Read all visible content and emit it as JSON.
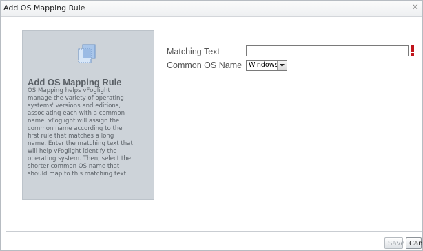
{
  "dialog": {
    "title": "Add OS Mapping Rule",
    "close_glyph": "×"
  },
  "help": {
    "icon": "copy-windows-icon",
    "title": "Add OS Mapping Rule",
    "lines": [
      "OS Mapping helps vFoglight",
      "manage the variety of operating",
      "systems' versions and editions,",
      "associating each with a common",
      "name. vFoglight will assign the",
      "common name according to the",
      "first rule that matches a long",
      "name. Enter the matching text that",
      "will help vFoglight identify the",
      "operating system. Then, select the",
      "shorter common OS name that",
      "should map to this matching text."
    ]
  },
  "form": {
    "matching_text_label": "Matching Text",
    "matching_text_value": "",
    "common_os_label": "Common OS Name",
    "common_os_selected": "Windows"
  },
  "buttons": {
    "save": "Save",
    "cancel": "Cancel"
  },
  "colors": {
    "help_panel_bg": "#cdd3d9",
    "required_mark": "#c0141b",
    "disabled_text": "#9aa0a6"
  }
}
